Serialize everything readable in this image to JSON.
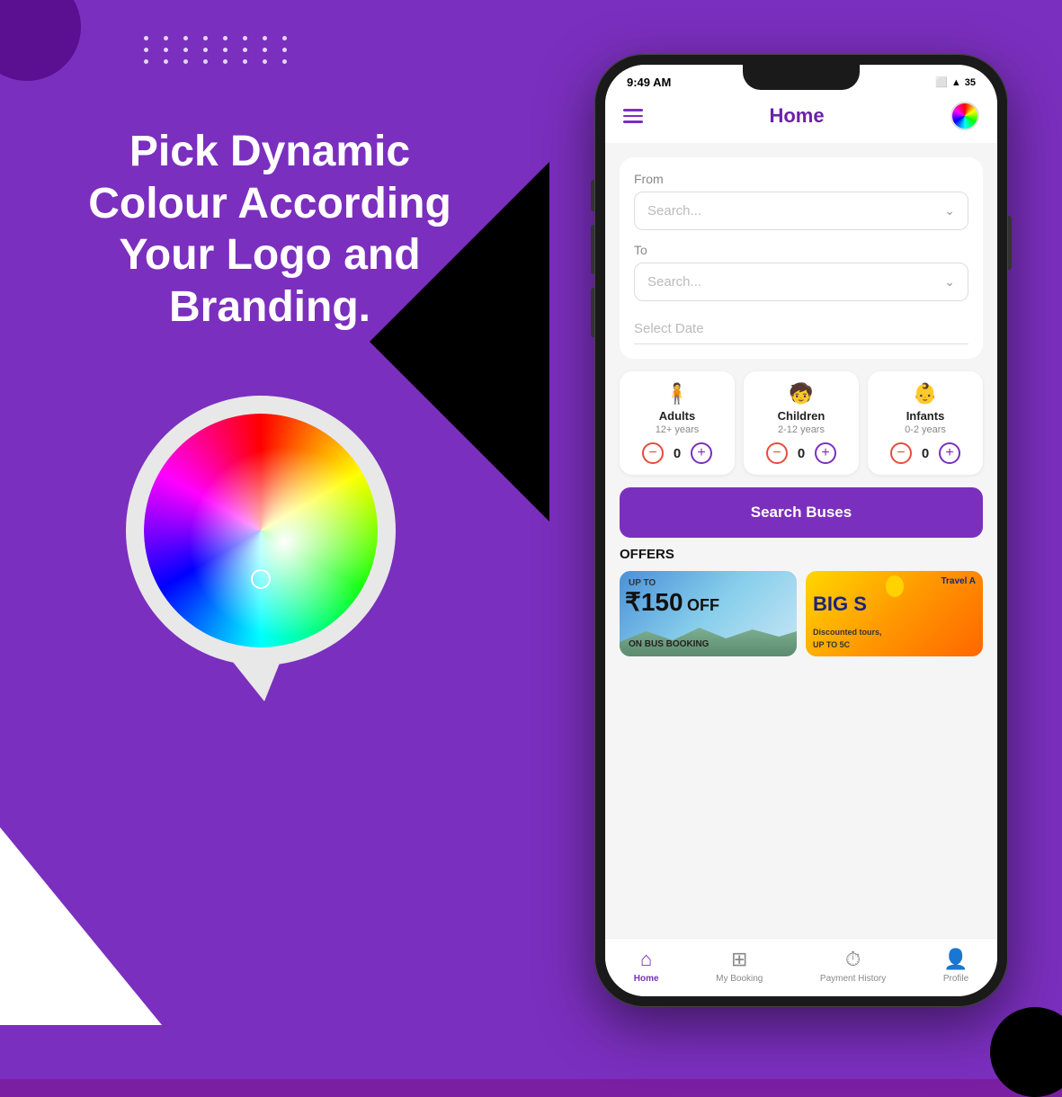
{
  "background": {
    "color": "#7B2FBE"
  },
  "left_section": {
    "headline": "Pick Dynamic Colour According Your Logo and Branding."
  },
  "dots": {
    "rows": 3,
    "cols": 8
  },
  "phone": {
    "status_bar": {
      "time": "9:49 AM",
      "battery": "35",
      "wifi": true
    },
    "header": {
      "title": "Home",
      "menu_icon": "hamburger",
      "color_icon": "color-wheel"
    },
    "form": {
      "from_label": "From",
      "from_placeholder": "Search...",
      "to_label": "To",
      "to_placeholder": "Search...",
      "date_placeholder": "Select Date"
    },
    "passengers": [
      {
        "type": "Adults",
        "age_range": "12+ years",
        "count": 0,
        "icon": "adult"
      },
      {
        "type": "Children",
        "age_range": "2-12 years",
        "count": 0,
        "icon": "child"
      },
      {
        "type": "Infants",
        "age_range": "0-2 years",
        "count": 0,
        "icon": "infant"
      }
    ],
    "search_button": "Search Buses",
    "offers_title": "OFFERS",
    "offers": [
      {
        "type": "discount",
        "amount": "₹150",
        "off_text": "OFF",
        "sub_text": "ON BUS BOOKING",
        "label": "UP TO"
      },
      {
        "type": "travel",
        "title": "Travel A",
        "big_text": "BIG S",
        "sub1": "Discounted tours,",
        "sub2": "UP TO 5C"
      }
    ],
    "bottom_nav": [
      {
        "label": "Home",
        "icon": "home",
        "active": true
      },
      {
        "label": "My Booking",
        "icon": "booking",
        "active": false
      },
      {
        "label": "Payment History",
        "icon": "clock",
        "active": false
      },
      {
        "label": "Profile",
        "icon": "profile",
        "active": false
      }
    ]
  }
}
